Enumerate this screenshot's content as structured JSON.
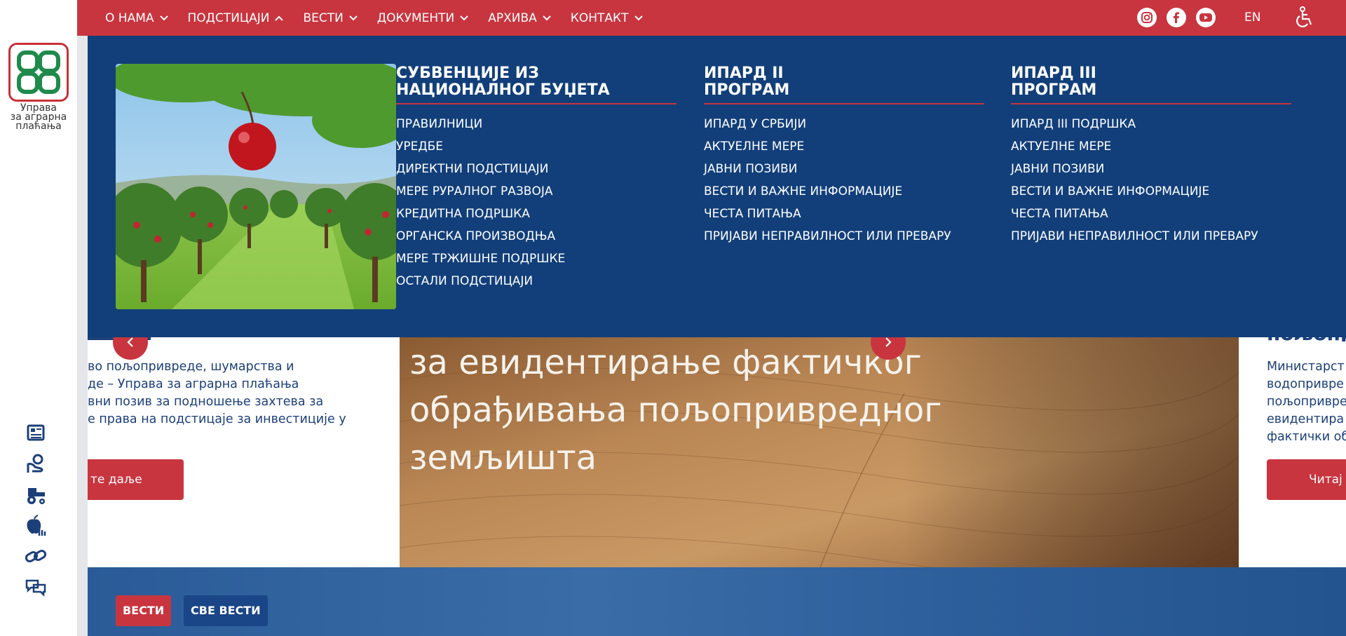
{
  "brand": {
    "logo_text": [
      "Управа",
      "за аграрна",
      "плаћања"
    ]
  },
  "nav": {
    "items": [
      {
        "label": "О НАМА",
        "expanded": false
      },
      {
        "label": "ПОДСТИЦАЈИ",
        "expanded": true
      },
      {
        "label": "ВЕСТИ",
        "expanded": false
      },
      {
        "label": "ДОКУМЕНТИ",
        "expanded": false
      },
      {
        "label": "АРХИВА",
        "expanded": false
      },
      {
        "label": "КОНТАКТ",
        "expanded": false
      }
    ],
    "social": [
      "instagram-icon",
      "facebook-icon",
      "youtube-icon"
    ],
    "language": "EN",
    "accessibility_icon": "wheelchair-icon"
  },
  "mega_menu": {
    "columns": [
      {
        "title": [
          "СУБВЕНЦИЈЕ ИЗ",
          "НАЦИОНАЛНОГ БУЏЕТА"
        ],
        "items": [
          "ПРАВИЛНИЦИ",
          "УРЕДБЕ",
          "ДИРЕКТНИ ПОДСТИЦАЈИ",
          "МЕРЕ РУРАЛНОГ РАЗВОЈА",
          "КРЕДИТНА ПОДРШКА",
          "ОРГАНСКА ПРОИЗВОДЊА",
          "МЕРЕ ТРЖИШНЕ ПОДРШКЕ",
          "ОСТАЛИ ПОДСТИЦАЈИ"
        ]
      },
      {
        "title": [
          "ИПАРД II",
          "ПРОГРАМ"
        ],
        "items": [
          "ИПАРД У СРБИЈИ",
          "АКТУЕЛНЕ МЕРЕ",
          "ЈАВНИ ПОЗИВИ",
          "ВЕСТИ И ВАЖНЕ ИНФОРМАЦИЈЕ",
          "ЧЕСТА ПИТАЊА",
          "ПРИЈАВИ НЕПРАВИЛНОСТ ИЛИ ПРЕВАРУ"
        ]
      },
      {
        "title": [
          "ИПАРД III",
          "ПРОГРАМ"
        ],
        "items": [
          "ИПАРД III ПОДРШКА",
          "АКТУЕЛНЕ МЕРЕ",
          "ЈАВНИ ПОЗИВИ",
          "ВЕСТИ И ВАЖНЕ ИНФОРМАЦИЈЕ",
          "ЧЕСТА ПИТАЊА",
          "ПРИЈАВИ НЕПРАВИЛНОСТ ИЛИ ПРЕВАРУ"
        ]
      }
    ]
  },
  "carousel": {
    "left_slide": {
      "text_lines": [
        "во пољопривреде, шумарства и",
        "де – Управа за аграрна плаћања",
        "вни позив за подношење захтева за",
        "е права на подстицаје за инвестиције у"
      ],
      "button": "те даље"
    },
    "center_slide": {
      "headline_lines": [
        "за евидентирање фактичког",
        "обрађивања пољопривредног",
        "земљишта"
      ]
    },
    "right_slide": {
      "heading": "пољопр",
      "text_lines": [
        "Министарст",
        "водопривре",
        "пољопривре",
        "евидентира",
        "фактички об"
      ],
      "button": "Читај"
    }
  },
  "sidebar_icons": [
    "newspaper-icon",
    "hand-coins-icon",
    "tractor-icon",
    "apple-hand-icon",
    "link-icon",
    "chat-icon"
  ],
  "news": {
    "tag": "ВЕСТИ",
    "all_news": "СВЕ ВЕСТИ"
  },
  "colors": {
    "red": "#c8353f",
    "navy": "#123f7a",
    "link_blue": "#1c3f7a"
  }
}
